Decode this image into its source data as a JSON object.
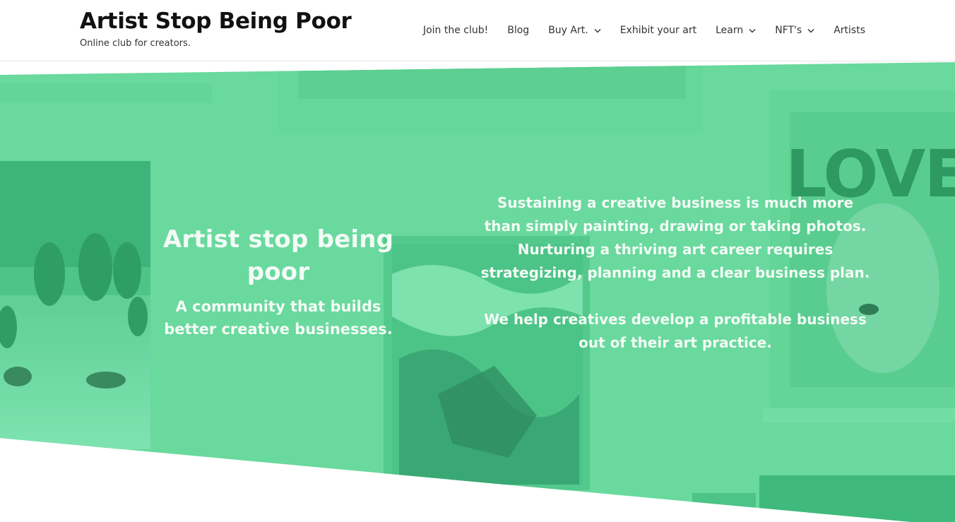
{
  "header": {
    "site_title": "Artist Stop Being Poor",
    "tagline": "Online club for creators.",
    "nav": [
      {
        "label": "Join the club!",
        "has_dropdown": false
      },
      {
        "label": "Blog",
        "has_dropdown": false
      },
      {
        "label": "Buy Art.",
        "has_dropdown": true
      },
      {
        "label": "Exhibit your art",
        "has_dropdown": false
      },
      {
        "label": "Learn",
        "has_dropdown": true
      },
      {
        "label": "NFT's",
        "has_dropdown": true
      },
      {
        "label": "Artists",
        "has_dropdown": false
      }
    ]
  },
  "hero": {
    "title": "Artist stop being poor",
    "subtitle": "A community that builds better creative businesses.",
    "paragraph_1": "Sustaining a creative business is much more than simply painting, drawing or taking photos. Nurturing a thriving art career requires strategizing, planning and a clear business plan.",
    "paragraph_2": "We help creatives develop a profitable business out of their art practice.",
    "artwork_text": "LOVE"
  },
  "colors": {
    "overlay_green": "#69d99d",
    "text_light": "#f3fbf6",
    "text_dark": "#111111"
  }
}
